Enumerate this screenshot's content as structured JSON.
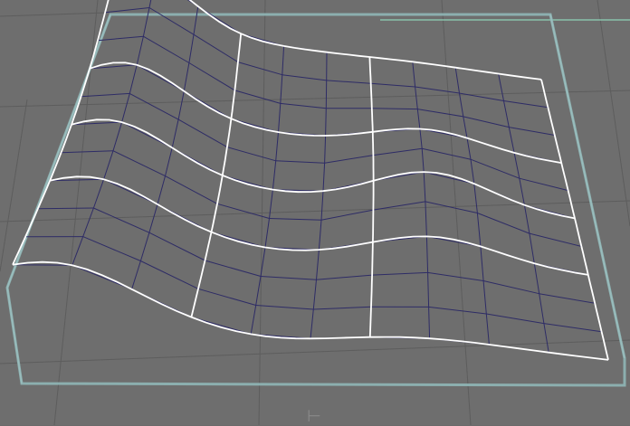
{
  "viewport": {
    "kind": "3d-viewport",
    "object": "nurbs-plane",
    "grid_visible": true,
    "selection_highlight": "cyan-bounding-box",
    "wireframe_color": "#2e2c66",
    "edge_highlight_color": "#ffffff",
    "background_color": "#6e6e6e",
    "bounding_box_color": "#8fb6b6",
    "horizon_color": "#8fd3b9"
  },
  "manipulator": {
    "icon": "move-manipulator-icon",
    "glyph": "⊢"
  }
}
